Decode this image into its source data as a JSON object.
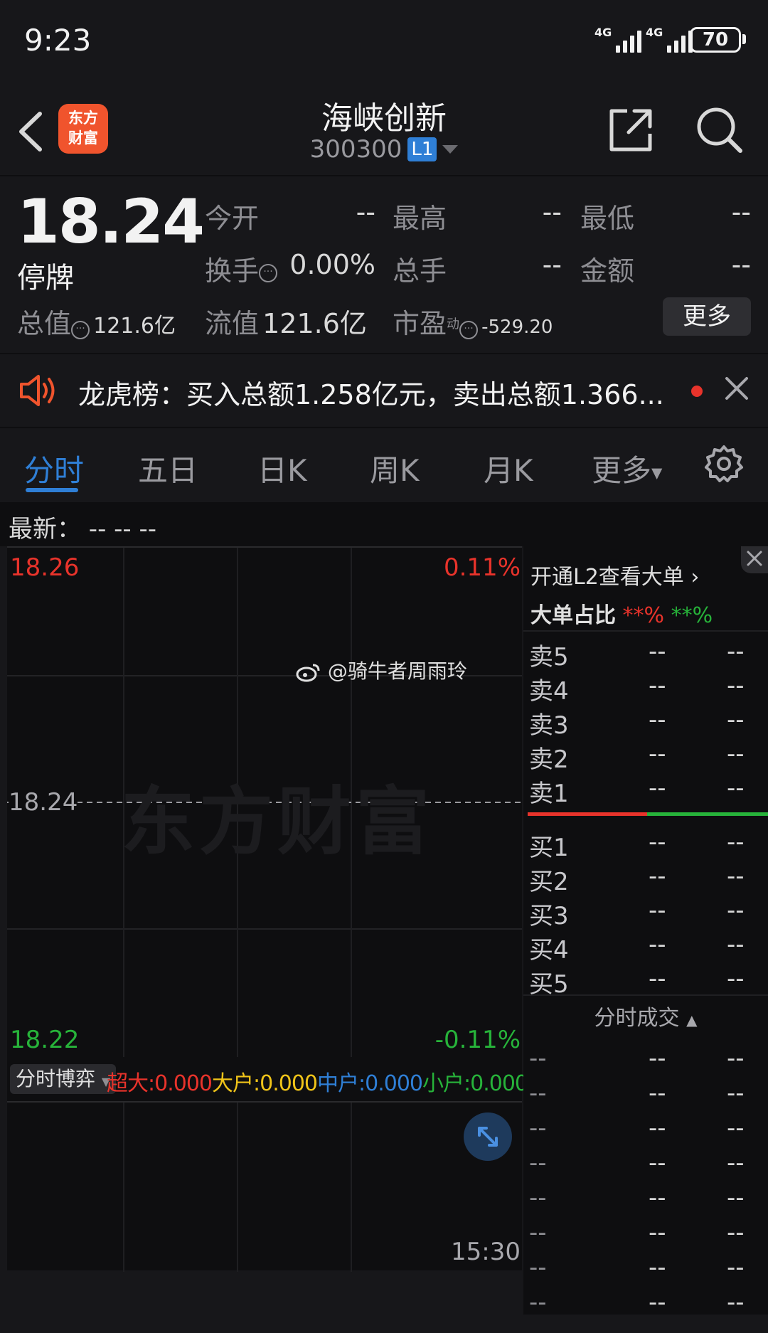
{
  "status_bar": {
    "time": "9:23",
    "network1": "4G",
    "network2": "4G",
    "battery": "70"
  },
  "header": {
    "app_logo_line1": "东方",
    "app_logo_line2": "财富",
    "stock_name": "海峡创新",
    "stock_code": "300300",
    "level_badge": "L1"
  },
  "quote": {
    "price": "18.24",
    "status": "停牌",
    "open_label": "今开",
    "open_value": "--",
    "high_label": "最高",
    "high_value": "--",
    "low_label": "最低",
    "low_value": "--",
    "turnover_label": "换手",
    "turnover_value": "0.00%",
    "volume_label": "总手",
    "volume_value": "--",
    "amount_label": "金额",
    "amount_value": "--",
    "mktcap_label": "总值",
    "mktcap_value": "121.6亿",
    "float_label": "流值",
    "float_value": "121.6亿",
    "pe_label": "市盈",
    "pe_sup": "动",
    "pe_value": "-529.20",
    "more_label": "更多"
  },
  "news": {
    "text": "龙虎榜：买入总额1.258亿元，卖出总额1.366..."
  },
  "tabs": [
    "分时",
    "五日",
    "日K",
    "周K",
    "月K",
    "更多"
  ],
  "latest": "最新：  --   --   --",
  "chart": {
    "price_top": "18.26",
    "pct_top": "0.11%",
    "price_mid": "18.24",
    "price_bottom": "18.22",
    "pct_bottom": "-0.11%",
    "watermark": "东方财富",
    "weibo_tag": "@骑牛者周雨玲",
    "time_end": "15:30",
    "colors": {
      "up": "#e8332b",
      "down": "#27b33a"
    }
  },
  "flow": {
    "selector": "分时博弈",
    "super_label": "超大",
    "super_value": ":0.000",
    "large_label": "大户",
    "large_value": ":0.000",
    "mid_label": "中户",
    "mid_value": ":0.000",
    "small_label": "小户",
    "small_value": ":0.000"
  },
  "order_book": {
    "l2_promo": "开通L2查看大单",
    "big_order_label": "大单占比",
    "big_red": "**%",
    "big_green": "**%",
    "sells": [
      {
        "label": "卖5",
        "price": "--",
        "vol": "--"
      },
      {
        "label": "卖4",
        "price": "--",
        "vol": "--"
      },
      {
        "label": "卖3",
        "price": "--",
        "vol": "--"
      },
      {
        "label": "卖2",
        "price": "--",
        "vol": "--"
      },
      {
        "label": "卖1",
        "price": "--",
        "vol": "--"
      }
    ],
    "buys": [
      {
        "label": "买1",
        "price": "--",
        "vol": "--"
      },
      {
        "label": "买2",
        "price": "--",
        "vol": "--"
      },
      {
        "label": "买3",
        "price": "--",
        "vol": "--"
      },
      {
        "label": "买4",
        "price": "--",
        "vol": "--"
      },
      {
        "label": "买5",
        "price": "--",
        "vol": "--"
      }
    ],
    "trades_title": "分时成交",
    "trades": [
      {
        "t": "--",
        "p": "--",
        "v": "--"
      },
      {
        "t": "--",
        "p": "--",
        "v": "--"
      },
      {
        "t": "--",
        "p": "--",
        "v": "--"
      },
      {
        "t": "--",
        "p": "--",
        "v": "--"
      },
      {
        "t": "--",
        "p": "--",
        "v": "--"
      },
      {
        "t": "--",
        "p": "--",
        "v": "--"
      },
      {
        "t": "--",
        "p": "--",
        "v": "--"
      },
      {
        "t": "--",
        "p": "--",
        "v": "--"
      }
    ]
  }
}
